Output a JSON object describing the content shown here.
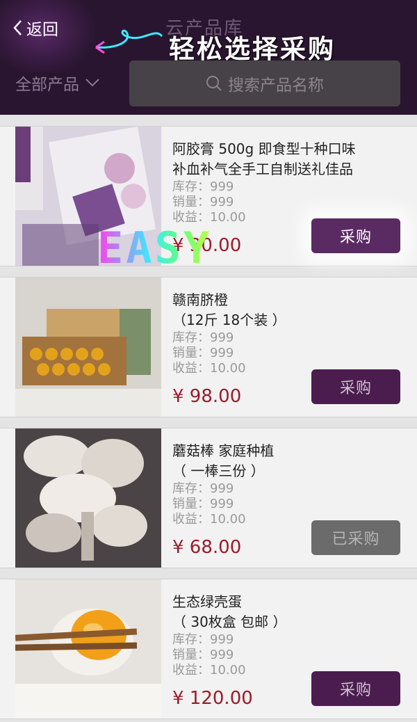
{
  "header": {
    "back_label": "返回",
    "title": "云产品库",
    "promo_text": "轻松选择采购",
    "category_label": "全部产品",
    "search_placeholder": "搜索产品名称"
  },
  "overlay": {
    "badge_text": "EASY"
  },
  "products": [
    {
      "name_line1": "阿胶膏 500g 即食型十种口味",
      "name_line2": "补血补气全手工自制送礼佳品",
      "stock": "库存：999",
      "sales": "销量：999",
      "profit": "收益：10.00",
      "price": "¥ 30.00",
      "button": "采购"
    },
    {
      "name_line1": "赣南脐橙",
      "name_line2": "（12斤 18个装 ）",
      "stock": "库存：999",
      "sales": "销量：999",
      "profit": "收益：10.00",
      "price": "¥ 98.00",
      "button": "采购"
    },
    {
      "name_line1": "蘑菇棒 家庭种植",
      "name_line2": "（ 一棒三份 ）",
      "stock": "库存：999",
      "sales": "销量：999",
      "profit": "收益：10.00",
      "price": "¥ 68.00",
      "button": "已采购"
    },
    {
      "name_line1": "生态绿壳蛋",
      "name_line2": "（ 30枚盒 包邮 ）",
      "stock": "库存：999",
      "sales": "销量：999",
      "profit": "收益：10.00",
      "price": "¥ 120.00",
      "button": "采购"
    }
  ]
}
